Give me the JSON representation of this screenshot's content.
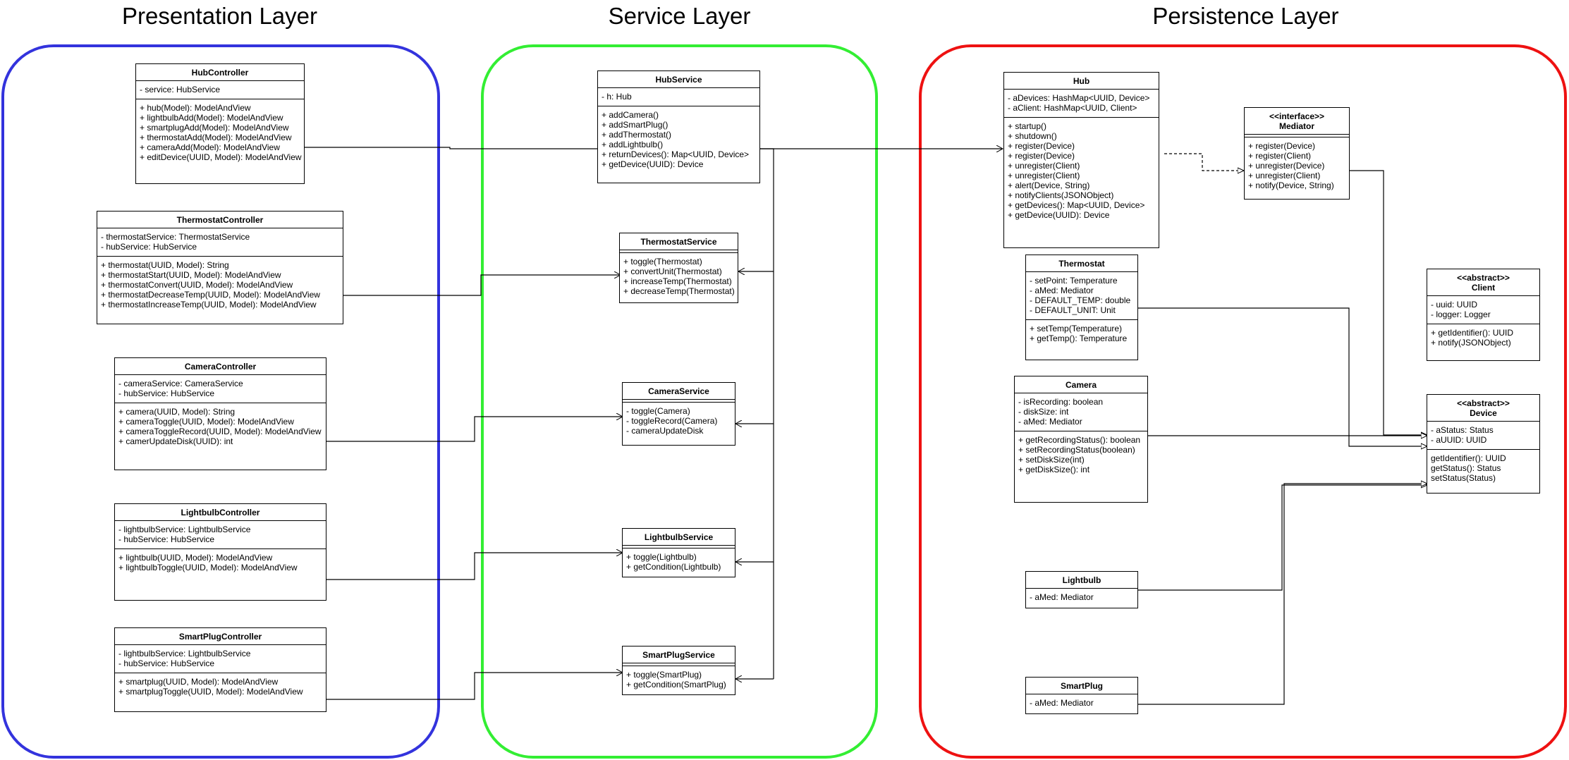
{
  "layers": [
    {
      "title": "Presentation Layer",
      "color": "#3333dd"
    },
    {
      "title": "Service Layer",
      "color": "#33ee33"
    },
    {
      "title": "Persistence Layer",
      "color": "#ee1111"
    }
  ],
  "classes": {
    "hub_controller": {
      "name": "HubController",
      "attributes": [
        "- service: HubService"
      ],
      "operations": [
        "+ hub(Model): ModelAndView",
        "+ lightbulbAdd(Model): ModelAndView",
        "+ smartplugAdd(Model): ModelAndView",
        "+ thermostatAdd(Model): ModelAndView",
        "+ cameraAdd(Model): ModelAndView",
        "+ editDevice(UUID, Model): ModelAndView"
      ]
    },
    "thermostat_controller": {
      "name": "ThermostatController",
      "attributes": [
        "- thermostatService: ThermostatService",
        "- hubService: HubService"
      ],
      "operations": [
        "+ thermostat(UUID, Model): String",
        "+ thermostatStart(UUID, Model): ModelAndView",
        "+ thermostatConvert(UUID, Model): ModelAndView",
        "+ thermostatDecreaseTemp(UUID, Model): ModelAndView",
        "+ thermostatIncreaseTemp(UUID, Model): ModelAndView"
      ]
    },
    "camera_controller": {
      "name": "CameraController",
      "attributes": [
        "- cameraService: CameraService",
        "- hubService: HubService"
      ],
      "operations": [
        "+ camera(UUID, Model): String",
        "+ cameraToggle(UUID, Model): ModelAndView",
        "+ cameraToggleRecord(UUID, Model): ModelAndView",
        "+ camerUpdateDisk(UUID): int"
      ]
    },
    "lightbulb_controller": {
      "name": "LightbulbController",
      "attributes": [
        "- lightbulbService: LightbulbService",
        "- hubService: HubService"
      ],
      "operations": [
        "+ lightbulb(UUID, Model): ModelAndView",
        "+ lightbulbToggle(UUID, Model): ModelAndView"
      ]
    },
    "smartplug_controller": {
      "name": "SmartPlugController",
      "attributes": [
        "- lightbulbService: LightbulbService",
        "- hubService: HubService"
      ],
      "operations": [
        "+ smartplug(UUID, Model): ModelAndView",
        "+ smartplugToggle(UUID, Model): ModelAndView"
      ]
    },
    "hub_service": {
      "name": "HubService",
      "attributes": [
        "- h: Hub"
      ],
      "operations": [
        "+ addCamera()",
        "+ addSmartPlug()",
        "+ addThermostat()",
        "+ addLightbulb()",
        "+ returnDevices(): Map<UUID, Device>",
        "+ getDevice(UUID): Device"
      ]
    },
    "thermostat_service": {
      "name": "ThermostatService",
      "attributes": [],
      "operations": [
        "+ toggle(Thermostat)",
        "+ convertUnit(Thermostat)",
        "+ increaseTemp(Thermostat)",
        "+ decreaseTemp(Thermostat)"
      ]
    },
    "camera_service": {
      "name": "CameraService",
      "attributes": [],
      "operations": [
        "- toggle(Camera)",
        "- toggleRecord(Camera)",
        "- cameraUpdateDisk"
      ]
    },
    "lightbulb_service": {
      "name": "LightbulbService",
      "attributes": [],
      "operations": [
        "+ toggle(Lightbulb)",
        "+ getCondition(Lightbulb)"
      ]
    },
    "smartplug_service": {
      "name": "SmartPlugService",
      "attributes": [],
      "operations": [
        "+ toggle(SmartPlug)",
        "+ getCondition(SmartPlug)"
      ]
    },
    "hub": {
      "name": "Hub",
      "attributes": [
        "- aDevices: HashMap<UUID, Device>",
        "- aClient: HashMap<UUID, Client>"
      ],
      "operations": [
        "+ startup()",
        "+ shutdown()",
        "+ register(Device)",
        "+ register(Device)",
        "+ unregister(Client)",
        "+ unregister(Client)",
        "+ alert(Device, String)",
        "+ notifyClients(JSONObject)",
        "+ getDevices(): Map<UUID, Device>",
        "+ getDevice(UUID): Device"
      ]
    },
    "mediator": {
      "stereotype": "<<interface>>",
      "name": "Mediator",
      "attributes": [],
      "operations": [
        "+ register(Device)",
        "+ register(Client)",
        "+ unregister(Device)",
        "+ unregister(Client)",
        "+ notify(Device, String)"
      ]
    },
    "thermostat": {
      "name": "Thermostat",
      "attributes": [
        "- setPoint: Temperature",
        "- aMed: Mediator",
        "- DEFAULT_TEMP: double",
        "- DEFAULT_UNIT: Unit"
      ],
      "operations": [
        "+ setTemp(Temperature)",
        "+ getTemp(): Temperature"
      ]
    },
    "client": {
      "stereotype": "<<abstract>>",
      "name": "Client",
      "attributes": [
        "- uuid: UUID",
        "- logger: Logger"
      ],
      "operations": [
        "+ getIdentifier(): UUID",
        "+ notify(JSONObject)"
      ]
    },
    "camera": {
      "name": "Camera",
      "attributes": [
        "- isRecording: boolean",
        "- diskSize: int",
        "- aMed: Mediator"
      ],
      "operations": [
        "+ getRecordingStatus(): boolean",
        "+ setRecordingStatus(boolean)",
        "+ setDiskSize(int)",
        "+ getDiskSize(): int"
      ]
    },
    "device": {
      "stereotype": "<<abstract>>",
      "name": "Device",
      "attributes": [
        "- aStatus: Status",
        "- aUUID: UUID"
      ],
      "operations": [
        "getIdentifier(): UUID",
        "getStatus(): Status",
        "setStatus(Status)"
      ]
    },
    "lightbulb": {
      "name": "Lightbulb",
      "attributes": [
        "- aMed: Mediator"
      ],
      "operations": null
    },
    "smartplug": {
      "name": "SmartPlug",
      "attributes": [
        "- aMed: Mediator"
      ],
      "operations": null
    }
  }
}
